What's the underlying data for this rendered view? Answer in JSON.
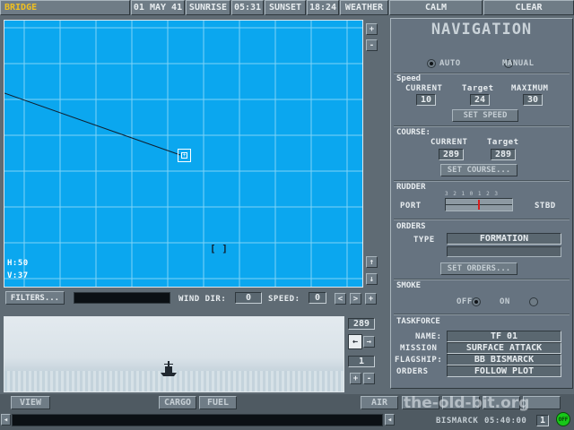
{
  "topbar": {
    "location": "BRIDGE",
    "date": "01 MAY 41",
    "sunrise_label": "SUNRISE",
    "sunrise_time": "05:31",
    "sunset_label": "SUNSET",
    "sunset_time": "18:24",
    "weather_label": "WEATHER",
    "sea": "CALM",
    "sky": "CLEAR"
  },
  "map": {
    "zoom_in": "+",
    "zoom_out": "-",
    "h_readout": "H:50",
    "v_readout": "V:37",
    "scroll_up": "↑",
    "scroll_down": "↓",
    "cursor_glyph": "[ ]"
  },
  "map_controls": {
    "filters": "FILTERS...",
    "wind_dir_label": "WIND DIR:",
    "wind_dir_value": "0",
    "speed_label": "SPEED:",
    "speed_value": "0",
    "left": "<",
    "right": ">",
    "fast": "+"
  },
  "scene": {
    "heading": "289",
    "page": "1",
    "plus": "+",
    "minus": "-",
    "arrow_right": "→",
    "arrow_left": "←"
  },
  "navigation": {
    "title": "NAVIGATION",
    "auto": "AUTO",
    "manual": "MANUAL",
    "speed_title": "Speed",
    "speed_current_label": "CURRENT",
    "speed_target_label": "Target",
    "speed_max_label": "MAXIMUM",
    "speed_current": "10",
    "speed_target": "24",
    "speed_max": "30",
    "set_speed": "SET SPEED",
    "course_title": "COURSE:",
    "course_current_label": "CURRENT",
    "course_target_label": "Target",
    "course_current": "289",
    "course_target": "289",
    "set_course": "SET COURSE...",
    "rudder_title": "RUDDER",
    "rudder_port": "PORT",
    "rudder_stbd": "STBD",
    "rudder_scale": "3 2 1 0 1 2 3",
    "orders_title": "ORDERS",
    "orders_type_label": "TYPE",
    "orders_type": "FORMATION",
    "set_orders": "SET ORDERS...",
    "smoke_title": "SMOKE",
    "smoke_off": "OFF",
    "smoke_on": "ON",
    "taskforce_title": "TASKFORCE",
    "tf_name_label": "NAME:",
    "tf_name": "TF 01",
    "tf_mission_label": "MISSION",
    "tf_mission": "SURFACE ATTACK",
    "tf_flagship_label": "FLAGSHIP:",
    "tf_flagship": "BB BISMARCK",
    "tf_orders_label": "ORDERS",
    "tf_orders": "FOLLOW PLOT"
  },
  "bottombar": {
    "view": "VIEW",
    "cargo": "CARGO",
    "fuel": "FUEL",
    "air": "AIR",
    "ship_name": "BISMARCK",
    "clock": "05:40:00",
    "speed_ind": "1",
    "status_icon": "OFF",
    "watermark": "the-old-bit.org"
  },
  "colors": {
    "sea": "#0ba7ef",
    "panel": "#5f6b74",
    "rudder_marker": "#d81e1e",
    "status_green": "#18c818"
  }
}
